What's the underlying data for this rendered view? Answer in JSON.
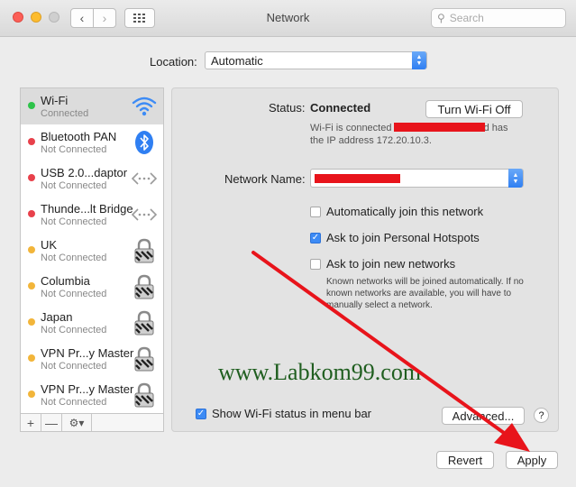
{
  "window": {
    "title": "Network",
    "search_placeholder": "Search"
  },
  "location": {
    "label": "Location:",
    "value": "Automatic"
  },
  "services": [
    {
      "name": "Wi-Fi",
      "status": "Connected",
      "dot": "#2ec34a",
      "icon": "wifi-icon"
    },
    {
      "name": "Bluetooth PAN",
      "status": "Not Connected",
      "dot": "#e8414b",
      "icon": "bluetooth-icon"
    },
    {
      "name": "USB 2.0...daptor",
      "status": "Not Connected",
      "dot": "#e8414b",
      "icon": "ethernet-icon"
    },
    {
      "name": "Thunde...lt Bridge",
      "status": "Not Connected",
      "dot": "#e8414b",
      "icon": "ethernet-icon"
    },
    {
      "name": "UK",
      "status": "Not Connected",
      "dot": "#f2b53a",
      "icon": "vpn-lock-icon"
    },
    {
      "name": "Columbia",
      "status": "Not Connected",
      "dot": "#f2b53a",
      "icon": "vpn-lock-icon"
    },
    {
      "name": "Japan",
      "status": "Not Connected",
      "dot": "#f2b53a",
      "icon": "vpn-lock-icon"
    },
    {
      "name": "VPN Pr...y Master",
      "status": "Not Connected",
      "dot": "#f2b53a",
      "icon": "vpn-lock-icon"
    },
    {
      "name": "VPN Pr...y Master",
      "status": "Not Connected",
      "dot": "#f2b53a",
      "icon": "vpn-lock-icon"
    }
  ],
  "sidebar_controls": {
    "add": "+",
    "remove": "—",
    "gear": "⚙▾"
  },
  "detail": {
    "status_label": "Status:",
    "status_value": "Connected",
    "turn_off_label": "Turn Wi-Fi Off",
    "desc_line1_a": "Wi-Fi is connected",
    "desc_line1_b": "nd has",
    "desc_line2": "the IP address 172.20.10.3.",
    "network_name_label": "Network Name:",
    "auto_join": {
      "label": "Automatically join this network",
      "checked": false
    },
    "ask_hotspots": {
      "label": "Ask to join Personal Hotspots",
      "checked": true
    },
    "ask_new": {
      "label": "Ask to join new networks",
      "checked": false
    },
    "note": "Known networks will be joined automatically. If no known networks are available, you will have to manually select a network.",
    "show_status": {
      "label": "Show Wi-Fi status in menu bar",
      "checked": true
    },
    "advanced_label": "Advanced...",
    "help_label": "?"
  },
  "footer": {
    "revert_label": "Revert",
    "apply_label": "Apply"
  },
  "watermark": "www.Labkom99.com",
  "colors": {
    "accent": "#3d8bf5",
    "annotation_red": "#e8141b"
  }
}
